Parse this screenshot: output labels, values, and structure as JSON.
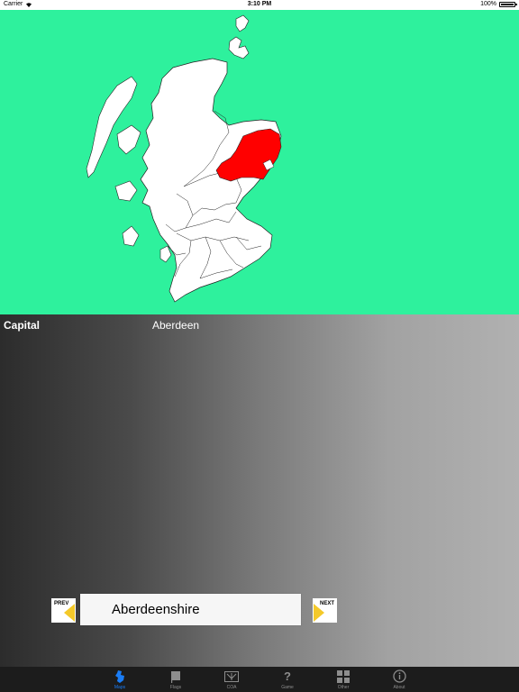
{
  "status_bar": {
    "carrier": "Carrier",
    "time": "3:10 PM",
    "battery": "100%"
  },
  "map": {
    "ocean_color": "#2ef19d",
    "land_color": "#ffffff",
    "highlight_color": "#ff0000",
    "highlighted_region": "Aberdeenshire"
  },
  "info": {
    "capital_label": "Capital",
    "capital_value": "Aberdeen"
  },
  "navigation": {
    "prev_label": "PREV",
    "next_label": "NEXT",
    "region_name": "Aberdeenshire"
  },
  "tabs": [
    {
      "label": "Maps",
      "icon": "map-icon",
      "active": true
    },
    {
      "label": "Flags",
      "icon": "flag-icon",
      "active": false
    },
    {
      "label": "COA",
      "icon": "coat-of-arms-icon",
      "active": false
    },
    {
      "label": "Game",
      "icon": "question-mark-icon",
      "active": false
    },
    {
      "label": "Other",
      "icon": "grid-icon",
      "active": false
    },
    {
      "label": "About",
      "icon": "info-icon",
      "active": false
    }
  ],
  "accent_color": "#1a7cf5"
}
